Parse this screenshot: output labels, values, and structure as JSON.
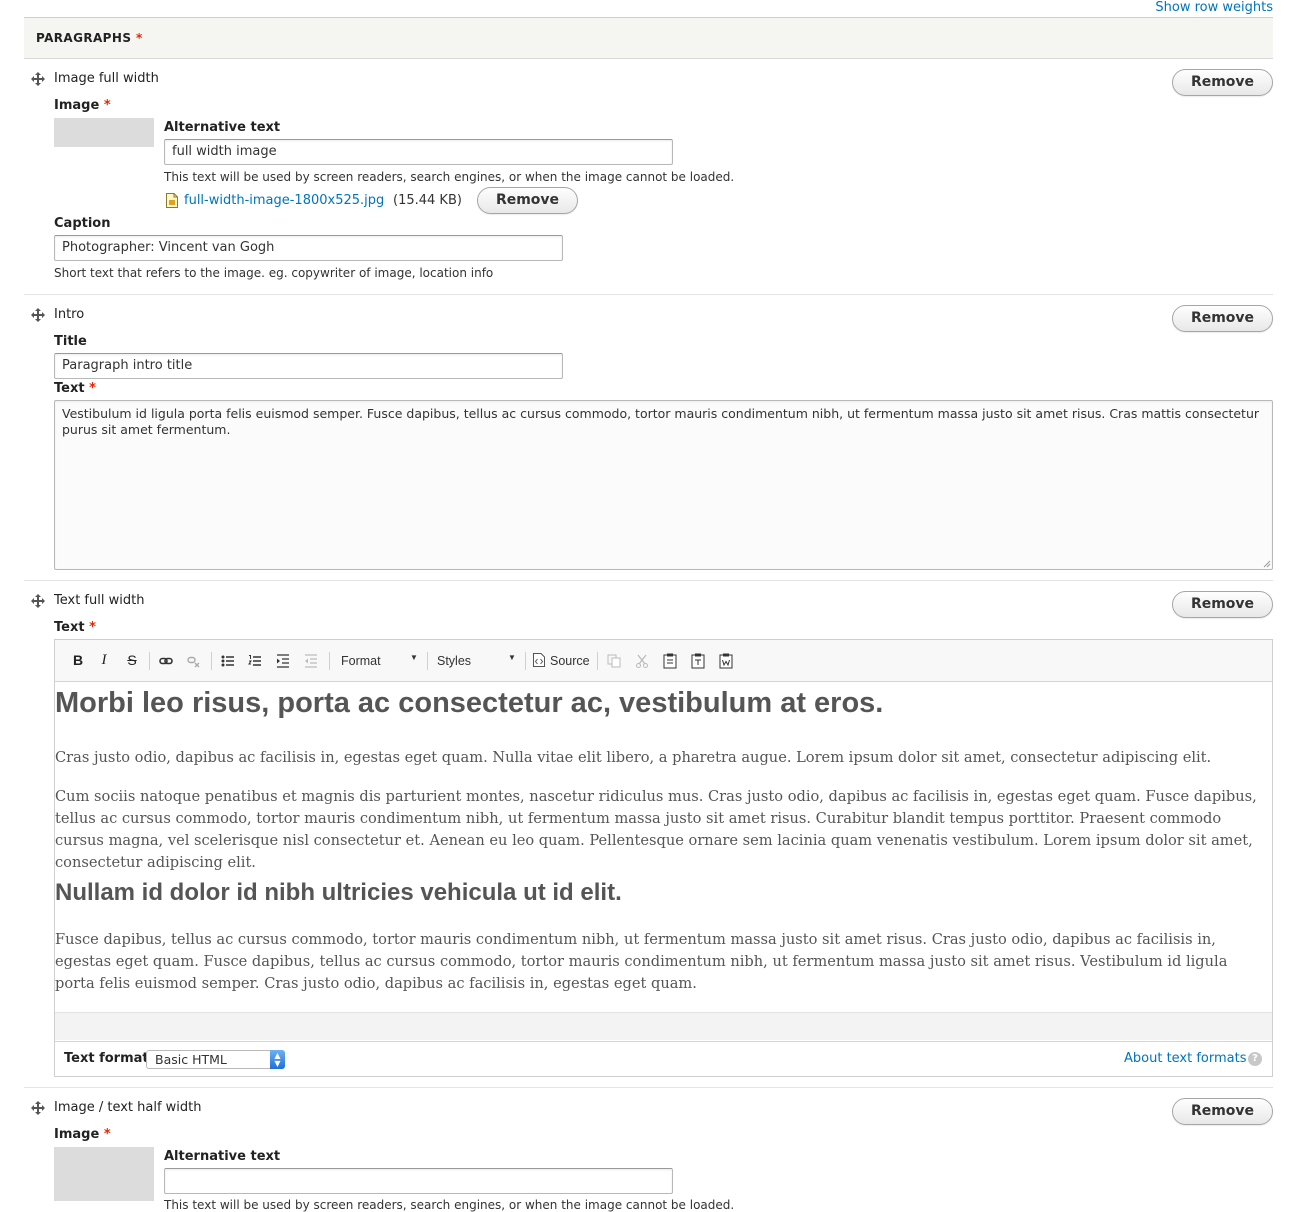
{
  "links": {
    "show_row_weights": "Show row weights"
  },
  "field": {
    "title": "PARAGRAPHS",
    "required": "*"
  },
  "buttons": {
    "remove": "Remove"
  },
  "paragraphs": [
    {
      "type": "Image full width",
      "image_label": "Image",
      "alt_label": "Alternative text",
      "alt_value": "full width image",
      "alt_desc": "This text will be used by screen readers, search engines, or when the image cannot be loaded.",
      "file_name": "full-width-image-1800x525.jpg",
      "file_size": "(15.44 KB)",
      "caption_label": "Caption",
      "caption_value": "Photographer: Vincent van Gogh",
      "caption_desc": "Short text that refers to the image. eg. copywriter of image, location info"
    },
    {
      "type": "Intro",
      "title_label": "Title",
      "title_value": "Paragraph intro title",
      "text_label": "Text",
      "text_value": "Vestibulum id ligula porta felis euismod semper. Fusce dapibus, tellus ac cursus commodo, tortor mauris condimentum nibh, ut fermentum massa justo sit amet risus. Cras mattis consectetur purus sit amet fermentum."
    },
    {
      "type": "Text full width",
      "text_label": "Text",
      "toolbar": {
        "bold": "B",
        "italic": "I",
        "strike": "S",
        "format": "Format",
        "styles": "Styles",
        "source": "Source"
      },
      "content": {
        "h1": "Morbi leo risus, porta ac consectetur ac, vestibulum at eros.",
        "p1": "Cras justo odio, dapibus ac facilisis in, egestas eget quam. Nulla vitae elit libero, a pharetra augue. Lorem ipsum dolor sit amet, consectetur adipiscing elit.",
        "p2": "Cum sociis natoque penatibus et magnis dis parturient montes, nascetur ridiculus mus. Cras justo odio, dapibus ac facilisis in, egestas eget quam. Fusce dapibus, tellus ac cursus commodo, tortor mauris condimentum nibh, ut fermentum massa justo sit amet risus. Curabitur blandit tempus porttitor. Praesent commodo cursus magna, vel scelerisque nisl consectetur et. Aenean eu leo quam. Pellentesque ornare sem lacinia quam venenatis vestibulum. Lorem ipsum dolor sit amet, consectetur adipiscing elit.",
        "h2": "Nullam id dolor id nibh ultricies vehicula ut id elit.",
        "p3": "Fusce dapibus, tellus ac cursus commodo, tortor mauris condimentum nibh, ut fermentum massa justo sit amet risus. Cras justo odio, dapibus ac facilisis in, egestas eget quam. Fusce dapibus, tellus ac cursus commodo, tortor mauris condimentum nibh, ut fermentum massa justo sit amet risus. Vestibulum id ligula porta felis euismod semper. Cras justo odio, dapibus ac facilisis in, egestas eget quam."
      },
      "text_format_label": "Text format",
      "text_format_value": "Basic HTML",
      "about_formats": "About text formats",
      "help_glyph": "?"
    },
    {
      "type": "Image / text half width",
      "image_label": "Image",
      "alt_label": "Alternative text",
      "alt_value": "",
      "alt_desc": "This text will be used by screen readers, search engines, or when the image cannot be loaded."
    }
  ],
  "icons": {
    "drag_handle": "drag-handle-icon",
    "file": "file-image-icon",
    "link": "link-icon",
    "unlink": "unlink-icon",
    "bullet_list": "bullet-list-icon",
    "numbered_list": "numbered-list-icon",
    "indent": "indent-icon",
    "outdent": "outdent-icon",
    "copy": "copy-icon",
    "cut": "cut-icon",
    "paste": "paste-icon",
    "paste_text": "paste-text-icon",
    "paste_word": "paste-word-icon"
  },
  "colors": {
    "link": "#0074bd",
    "required": "#e32700",
    "header_bg": "#f5f5f2"
  }
}
